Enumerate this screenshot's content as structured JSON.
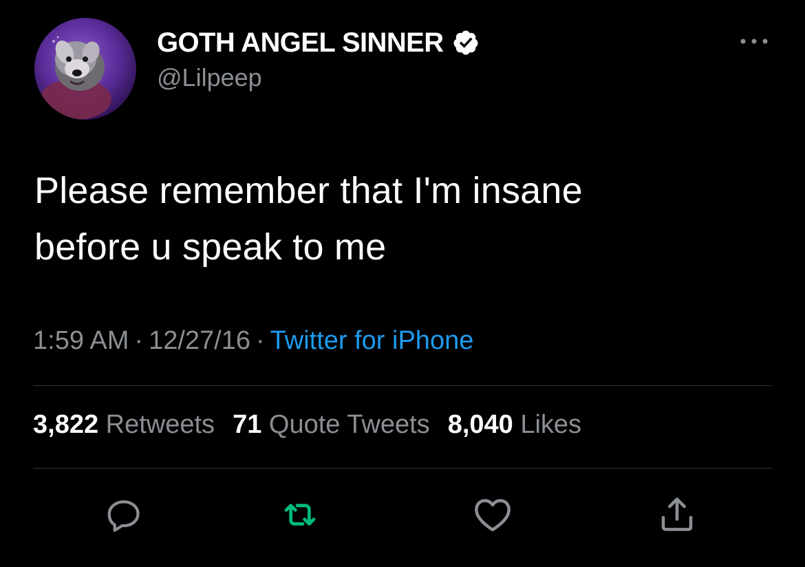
{
  "user": {
    "display_name": "GOTH ANGEL SINNER",
    "handle": "@Lilpeep",
    "verified": true,
    "avatar_icon": "dog-avatar"
  },
  "tweet": {
    "text_lines": [
      "Please remember that I'm insane",
      "before u speak to me"
    ],
    "time": "1:59 AM",
    "date": "12/27/16",
    "source": "Twitter for iPhone",
    "separator": "·"
  },
  "stats": {
    "retweets_count": "3,822",
    "retweets_label": "Retweets",
    "quotes_count": "71",
    "quotes_label": "Quote Tweets",
    "likes_count": "8,040",
    "likes_label": "Likes"
  },
  "actions": {
    "reply_icon": "reply-icon",
    "retweet_icon": "retweet-icon",
    "like_icon": "heart-icon",
    "share_icon": "share-icon",
    "more_icon": "more-icon"
  },
  "colors": {
    "background": "#000000",
    "text_primary": "#ffffff",
    "text_secondary": "#8b8f94",
    "link": "#1d9bf0",
    "retweeted": "#00ba7c",
    "divider": "#2f3336"
  }
}
